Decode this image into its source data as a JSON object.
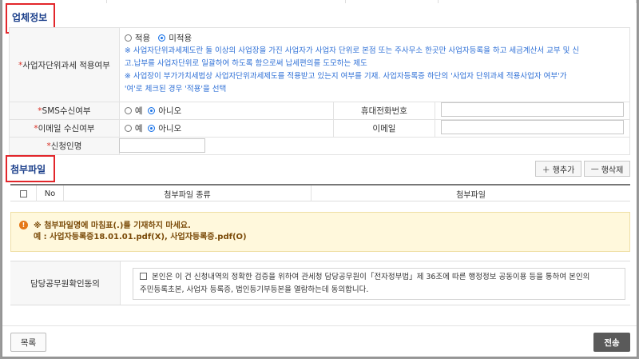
{
  "company_section": {
    "title": "업체정보",
    "unit_tax": {
      "label": "사업자단위과세 적용여부",
      "options": [
        "적용",
        "미적용"
      ],
      "selected": "미적용",
      "note1_line1": "※ 사업자단위과세제도란 둘 이상의 사업장을 가진 사업자가 사업자 단위로 본점 또는 주사무소 한곳만 사업자등록을 하고 세금계산서 교부 및 신",
      "note1_line2": "고.납부를 사업자단위로 일괄하여 하도록 함으로써 납세편의를 도모하는 제도",
      "note2_line1": "※ 사업장이 부가가치세법상 사업자단위과세제도를 적용받고 있는지 여부를 기재. 사업자등록증 하단의 '사업자 단위과세 적용사업자 여부'가",
      "note2_line2": "'여'로 체크된 경우 '적용'을 선택"
    },
    "sms": {
      "label": "SMS수신여부",
      "options": [
        "예",
        "아니오"
      ],
      "selected": "아니오"
    },
    "mobile": {
      "label": "휴대전화번호",
      "value": ""
    },
    "email_consent": {
      "label": "이메일 수신여부",
      "options": [
        "예",
        "아니오"
      ],
      "selected": "아니오"
    },
    "email": {
      "label": "이메일",
      "value": ""
    },
    "applicant": {
      "label": "신청인명",
      "value": ""
    }
  },
  "attachment_section": {
    "title": "첨부파일",
    "add_row": "행추가",
    "delete_row": "행삭제",
    "columns": [
      "No",
      "첨부파일 종류",
      "첨부파일"
    ],
    "warning_line1": "※ 첨부파일명에 마침표(.)를 기재하지 마세요.",
    "warning_line2": "예 : 사업자등록증18.01.01.pdf(X), 사업자등록증.pdf(O)"
  },
  "consent": {
    "label": "담당공무원확인동의",
    "text_line1": "본인은 이 건 신청내역의 정확한 검증을 위하여 관세청 담당공무원이「전자정부법」제 36조에 따른 행정정보 공동이용 등을 통하여 본인의",
    "text_line2": "주민등록초본, 사업자 등록증, 법인등기부등본을 열람하는데 동의합니다."
  },
  "buttons": {
    "list": "목록",
    "send": "전송"
  },
  "required_mark": "*",
  "colors": {
    "accent": "#1a3e8a",
    "required": "#d93025",
    "note": "#2d6fd6",
    "highlight_box": "#e2262b"
  }
}
